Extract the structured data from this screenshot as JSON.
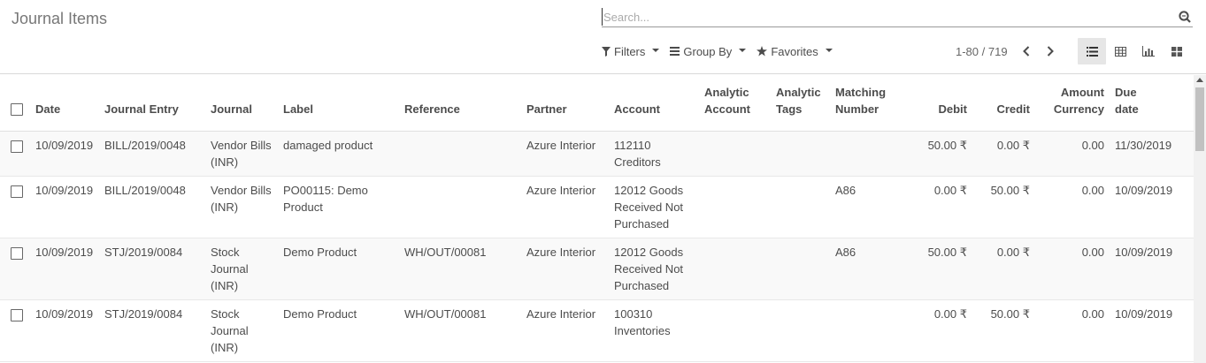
{
  "header": {
    "title": "Journal Items"
  },
  "search": {
    "placeholder": "Search..."
  },
  "toolbar": {
    "filters": "Filters",
    "group_by": "Group By",
    "favorites": "Favorites"
  },
  "pager": {
    "value": "1-80 / 719"
  },
  "views": [
    "list-view-icon",
    "pivot-view-icon",
    "graph-view-icon",
    "kanban-view-icon"
  ],
  "columns": {
    "date": "Date",
    "journal_entry": "Journal Entry",
    "journal": "Journal",
    "label": "Label",
    "reference": "Reference",
    "partner": "Partner",
    "account": "Account",
    "analytic_account_1": "Analytic",
    "analytic_account_2": "Account",
    "analytic_tags_1": "Analytic",
    "analytic_tags_2": "Tags",
    "matching_number_1": "Matching",
    "matching_number_2": "Number",
    "debit": "Debit",
    "credit": "Credit",
    "amount_currency_1": "Amount",
    "amount_currency_2": "Currency",
    "due_date_1": "Due",
    "due_date_2": "date"
  },
  "rows": [
    {
      "date": "10/09/2019",
      "entry": "BILL/2019/0048",
      "journal_1": "Vendor Bills",
      "journal_2": "(INR)",
      "journal_3": "",
      "label_1": "damaged product",
      "label_2": "",
      "reference": "",
      "partner": "Azure Interior",
      "account_1": "112110",
      "account_2": "Creditors",
      "account_3": "",
      "matching": "",
      "debit": "50.00 ₹",
      "credit": "0.00 ₹",
      "amount_currency": "0.00",
      "due_date": "11/30/2019"
    },
    {
      "date": "10/09/2019",
      "entry": "BILL/2019/0048",
      "journal_1": "Vendor Bills",
      "journal_2": "(INR)",
      "journal_3": "",
      "label_1": "PO00115: Demo",
      "label_2": "Product",
      "reference": "",
      "partner": "Azure Interior",
      "account_1": "12012 Goods",
      "account_2": "Received Not",
      "account_3": "Purchased",
      "matching": "A86",
      "debit": "0.00 ₹",
      "credit": "50.00 ₹",
      "amount_currency": "0.00",
      "due_date": "10/09/2019"
    },
    {
      "date": "10/09/2019",
      "entry": "STJ/2019/0084",
      "journal_1": "Stock",
      "journal_2": "Journal",
      "journal_3": "(INR)",
      "label_1": "Demo Product",
      "label_2": "",
      "reference": "WH/OUT/00081",
      "partner": "Azure Interior",
      "account_1": "12012 Goods",
      "account_2": "Received Not",
      "account_3": "Purchased",
      "matching": "A86",
      "debit": "50.00 ₹",
      "credit": "0.00 ₹",
      "amount_currency": "0.00",
      "due_date": "10/09/2019"
    },
    {
      "date": "10/09/2019",
      "entry": "STJ/2019/0084",
      "journal_1": "Stock",
      "journal_2": "Journal",
      "journal_3": "(INR)",
      "label_1": "Demo Product",
      "label_2": "",
      "reference": "WH/OUT/00081",
      "partner": "Azure Interior",
      "account_1": "100310",
      "account_2": "Inventories",
      "account_3": "",
      "matching": "",
      "debit": "0.00 ₹",
      "credit": "50.00 ₹",
      "amount_currency": "0.00",
      "due_date": "10/09/2019"
    }
  ]
}
